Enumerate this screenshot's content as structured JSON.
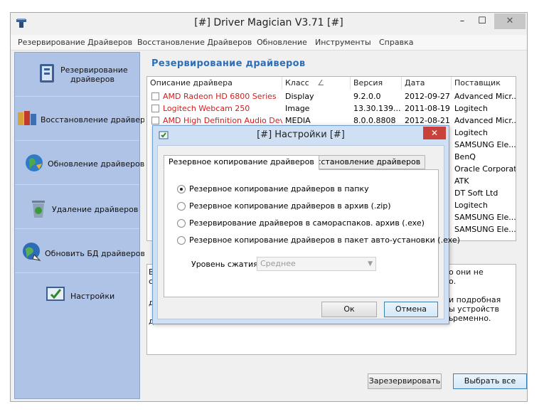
{
  "window": {
    "title": "[#] Driver Magician V3.71 [#]",
    "min": "–",
    "max": "☐",
    "close": "✕"
  },
  "menu": [
    "Резервирование Драйверов",
    "Восстановление Драйверов",
    "Обновление",
    "Инструменты",
    "Справка"
  ],
  "sidebar": [
    {
      "label": "Резервирование драйверов",
      "icon": "backup-icon"
    },
    {
      "label": "Восстановление драйверов",
      "icon": "restore-icon"
    },
    {
      "label": "Обновление драйверов",
      "icon": "update-globe-icon"
    },
    {
      "label": "Удаление драйверов",
      "icon": "recycle-bin-icon"
    },
    {
      "label": "Обновить БД драйверов",
      "icon": "database-update-icon"
    },
    {
      "label": "Настройки",
      "icon": "settings-icon"
    }
  ],
  "main": {
    "section_title": "Резервирование драйверов",
    "columns": [
      "Описание драйвера",
      "Класс",
      "Версия",
      "Дата",
      "Поставщик"
    ],
    "sort_indicator": "∠",
    "rows": [
      {
        "desc": "AMD Radeon HD 6800 Series",
        "class": "Display",
        "version": "9.2.0.0",
        "date": "2012-09-27",
        "vendor": "Advanced Micr..."
      },
      {
        "desc": "Logitech Webcam 250",
        "class": "Image",
        "version": "13.30.139....",
        "date": "2011-08-19",
        "vendor": "Logitech"
      },
      {
        "desc": "AMD High Definition Audio Device",
        "class": "MEDIA",
        "version": "8.0.0.8808",
        "date": "2012-08-21",
        "vendor": "Advanced Micr..."
      }
    ],
    "vendors_tail": [
      "Logitech",
      "SAMSUNG Ele...",
      "BenQ",
      "Oracle Corporat...",
      "ATK",
      "DT Soft Ltd",
      "Logitech",
      "SAMSUNG Ele...",
      "SAMSUNG Ele..."
    ],
    "desc_fragments": [
      "В",
      "с",
      "д",
      "д",
      "о они не",
      "о.",
      "и подробная",
      "ы устройств",
      "ь",
      "ременно."
    ],
    "backup_button": "Зарезервировать",
    "select_all_button": "Выбрать все"
  },
  "dialog": {
    "title": "[#] Настройки [#]",
    "close": "✕",
    "tabs": [
      "Резервное копирование драйверов",
      "Восстановление драйверов"
    ],
    "options": [
      {
        "label": "Резервное копирование драйверов в папку",
        "checked": true
      },
      {
        "label": "Резервное копирование драйверов в архив (.zip)",
        "checked": false
      },
      {
        "label": "Резервирование драйверов в самораспаков. архив (.exe)",
        "checked": false
      },
      {
        "label": "Резервное копирование драйверов в пакет авто-установки (.exe)",
        "checked": false
      }
    ],
    "compression_label": "Уровень сжатия",
    "compression_value": "Среднее",
    "ok": "Ок",
    "cancel": "Отмена"
  }
}
